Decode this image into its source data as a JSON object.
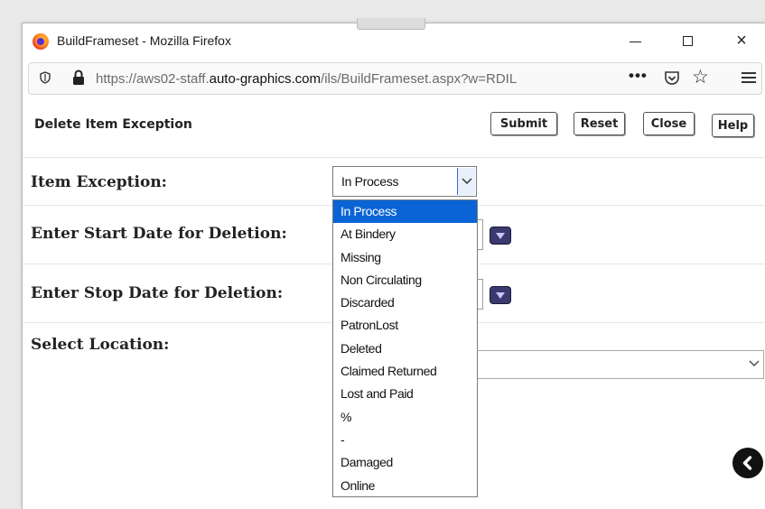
{
  "window": {
    "title": "BuildFrameset - Mozilla Firefox",
    "controls": {
      "minimize": "minimize",
      "maximize": "maximize",
      "close": "×"
    }
  },
  "urlbar": {
    "url_prefix": "https://aws02-staff.",
    "url_domain": "auto-graphics.com",
    "url_suffix": "/ils/BuildFrameset.aspx?w=RDIL",
    "more": "•••"
  },
  "page": {
    "title": "Delete Item Exception",
    "buttons": {
      "submit": "Submit",
      "reset": "Reset",
      "close": "Close",
      "help": "Help"
    },
    "fields": {
      "item_exception_label": "Item Exception:",
      "start_date_label": "Enter Start Date for Deletion:",
      "stop_date_label": "Enter Stop Date for Deletion:",
      "location_label": "Select Location:"
    },
    "item_exception": {
      "selected": "In Process",
      "options": [
        "In Process",
        "At Bindery",
        "Missing",
        "Non Circulating",
        "Discarded",
        "PatronLost",
        "Deleted",
        "Claimed Returned",
        "Lost and Paid",
        "%",
        "-",
        "Damaged",
        "Online"
      ],
      "highlighted_index": 0
    }
  },
  "colors": {
    "highlight": "#0a64d6",
    "calendar": "#3a3a6e"
  },
  "icons": [
    "firefox-logo-icon",
    "shield-icon",
    "lock-icon",
    "pocket-icon",
    "star-icon",
    "hamburger-menu-icon",
    "chevron-down-icon",
    "calendar-icon",
    "back-arrow-icon"
  ]
}
